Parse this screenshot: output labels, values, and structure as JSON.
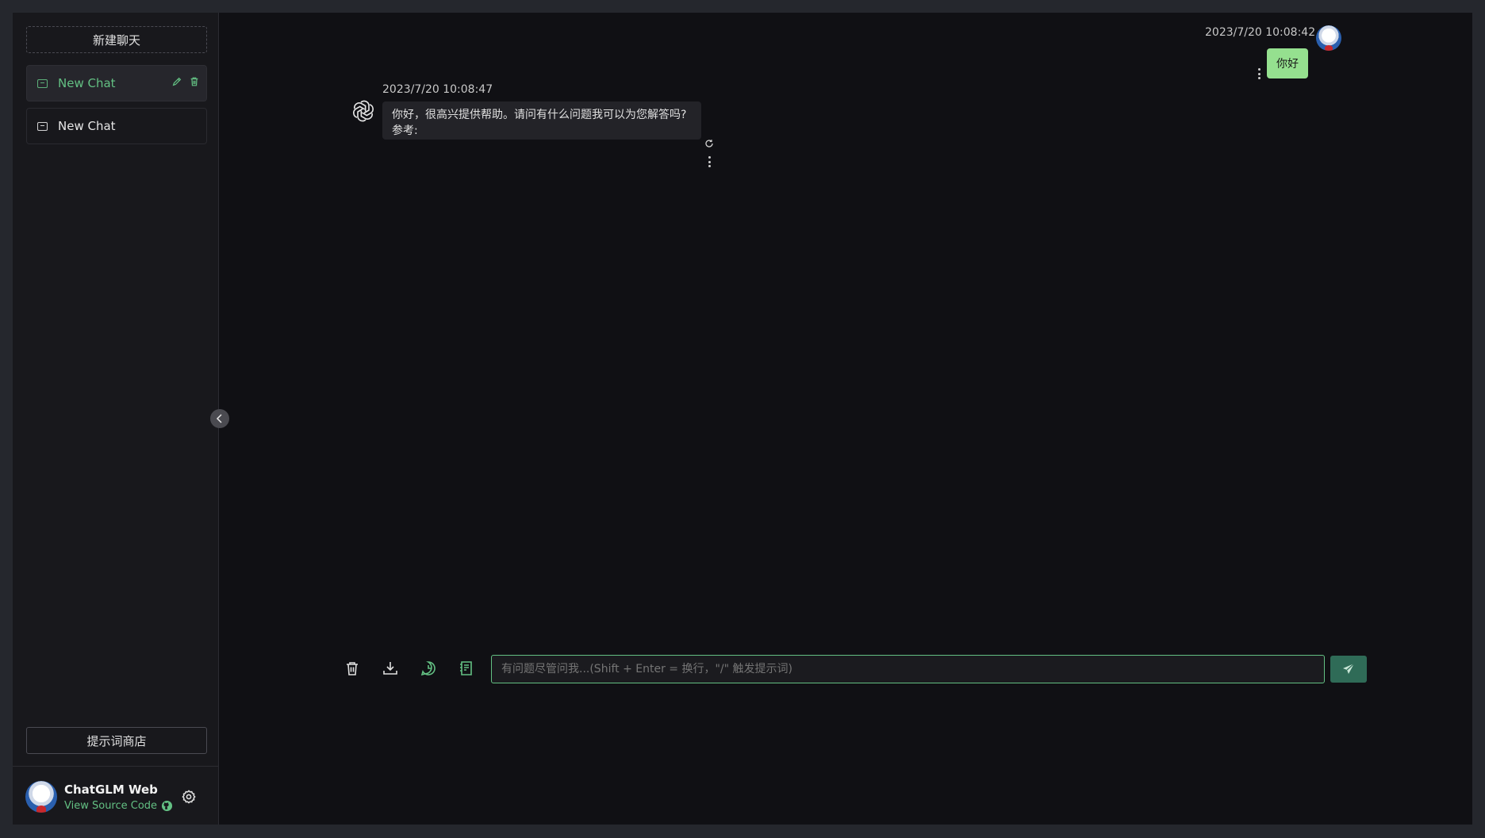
{
  "sidebar": {
    "new_chat_label": "新建聊天",
    "chats": [
      {
        "label": "New Chat",
        "active": true
      },
      {
        "label": "New Chat",
        "active": false
      }
    ],
    "prompt_store_label": "提示词商店",
    "footer": {
      "app_name": "ChatGLM Web",
      "source_link": "View Source Code"
    }
  },
  "messages": {
    "user": {
      "timestamp": "2023/7/20 10:08:42",
      "text": "你好"
    },
    "bot": {
      "timestamp": "2023/7/20 10:08:47",
      "line1": "你好，很高兴提供帮助。请问有什么问题我可以为您解答吗?",
      "line2": "参考:"
    }
  },
  "input": {
    "placeholder": "有问题尽管问我...(Shift + Enter = 换行，\"/\" 触发提示词)"
  },
  "colors": {
    "accent": "#63c083",
    "user_bubble": "#95e08f",
    "send_button": "#2f6b57",
    "background": "#101014",
    "sidebar": "#18181c"
  }
}
